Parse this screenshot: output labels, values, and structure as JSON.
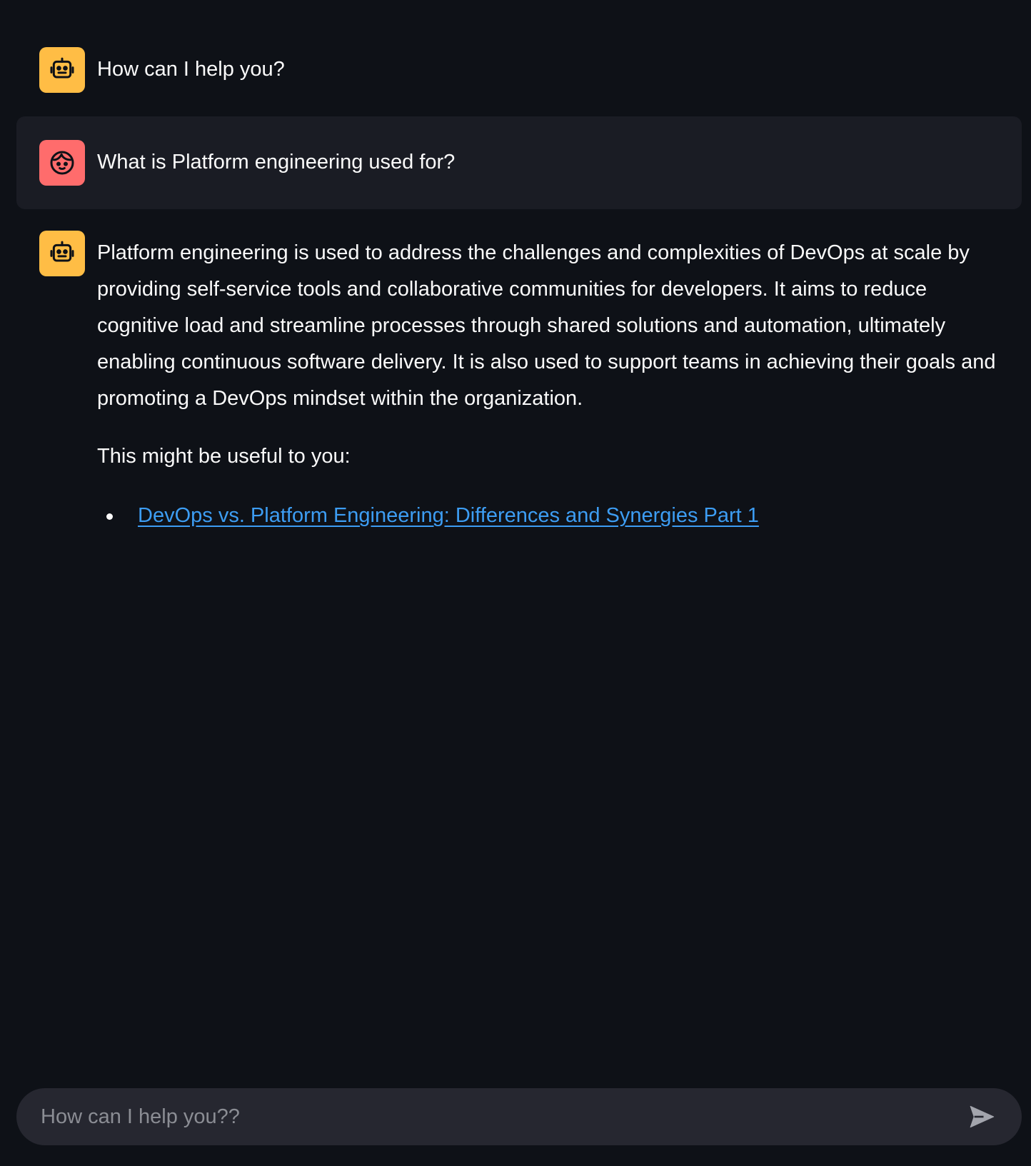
{
  "messages": [
    {
      "role": "assistant",
      "avatar_icon": "robot-icon",
      "text": "How can I help you?"
    },
    {
      "role": "user",
      "avatar_icon": "user-face-icon",
      "text": "What is Platform engineering used for?"
    },
    {
      "role": "assistant",
      "avatar_icon": "robot-icon",
      "paragraph": "Platform engineering is used to address the challenges and complexities of DevOps at scale by providing self-service tools and collaborative communities for developers. It aims to reduce cognitive load and streamline processes through shared solutions and automation, ultimately enabling continuous software delivery. It is also used to support teams in achieving their goals and promoting a DevOps mindset within the organization.",
      "intro": "This might be useful to you:",
      "links": [
        {
          "label": "DevOps vs. Platform Engineering: Differences and Synergies Part 1"
        }
      ]
    }
  ],
  "chat_input": {
    "placeholder": "How can I help you??",
    "send_icon": "send-arrow-icon"
  },
  "colors": {
    "background": "#0e1117",
    "user_bubble": "#1a1c24",
    "bot_avatar": "#ffbd45",
    "user_avatar": "#ff6c6c",
    "link": "#3d9df3",
    "input_bg": "#262730"
  }
}
